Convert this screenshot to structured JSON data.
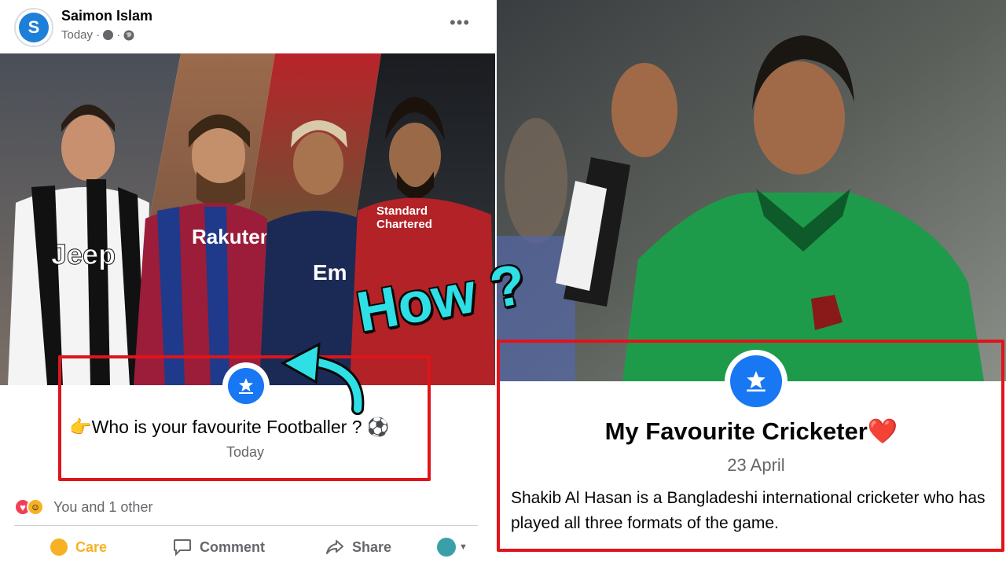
{
  "left_post": {
    "author": "Saimon Islam",
    "meta": "Today ·",
    "more": "•••",
    "title": "Who is your favourite Footballer ?",
    "title_prefix_emoji": "👉",
    "title_suffix_emoji": "⚽",
    "date": "Today",
    "reactions_text": "You and 1 other",
    "actions": {
      "care": "Care",
      "comment": "Comment",
      "share": "Share"
    }
  },
  "right_post": {
    "title": "My Favourite Cricketer",
    "title_emoji": "❤️",
    "date": "23 April",
    "description": "Shakib Al Hasan is a Bangladeshi international cricketer who has played all three formats of the game."
  },
  "overlay": {
    "how": "How ?"
  },
  "colors": {
    "highlight": "#e0141b",
    "accent_blue": "#1877f2",
    "how_cyan": "#2ee0e6",
    "care_yellow": "#f7b125"
  },
  "icons": [
    "clock-icon",
    "globe-icon",
    "more-icon",
    "life-event-star-icon",
    "care-icon",
    "comment-icon",
    "share-icon",
    "audience-icon"
  ]
}
